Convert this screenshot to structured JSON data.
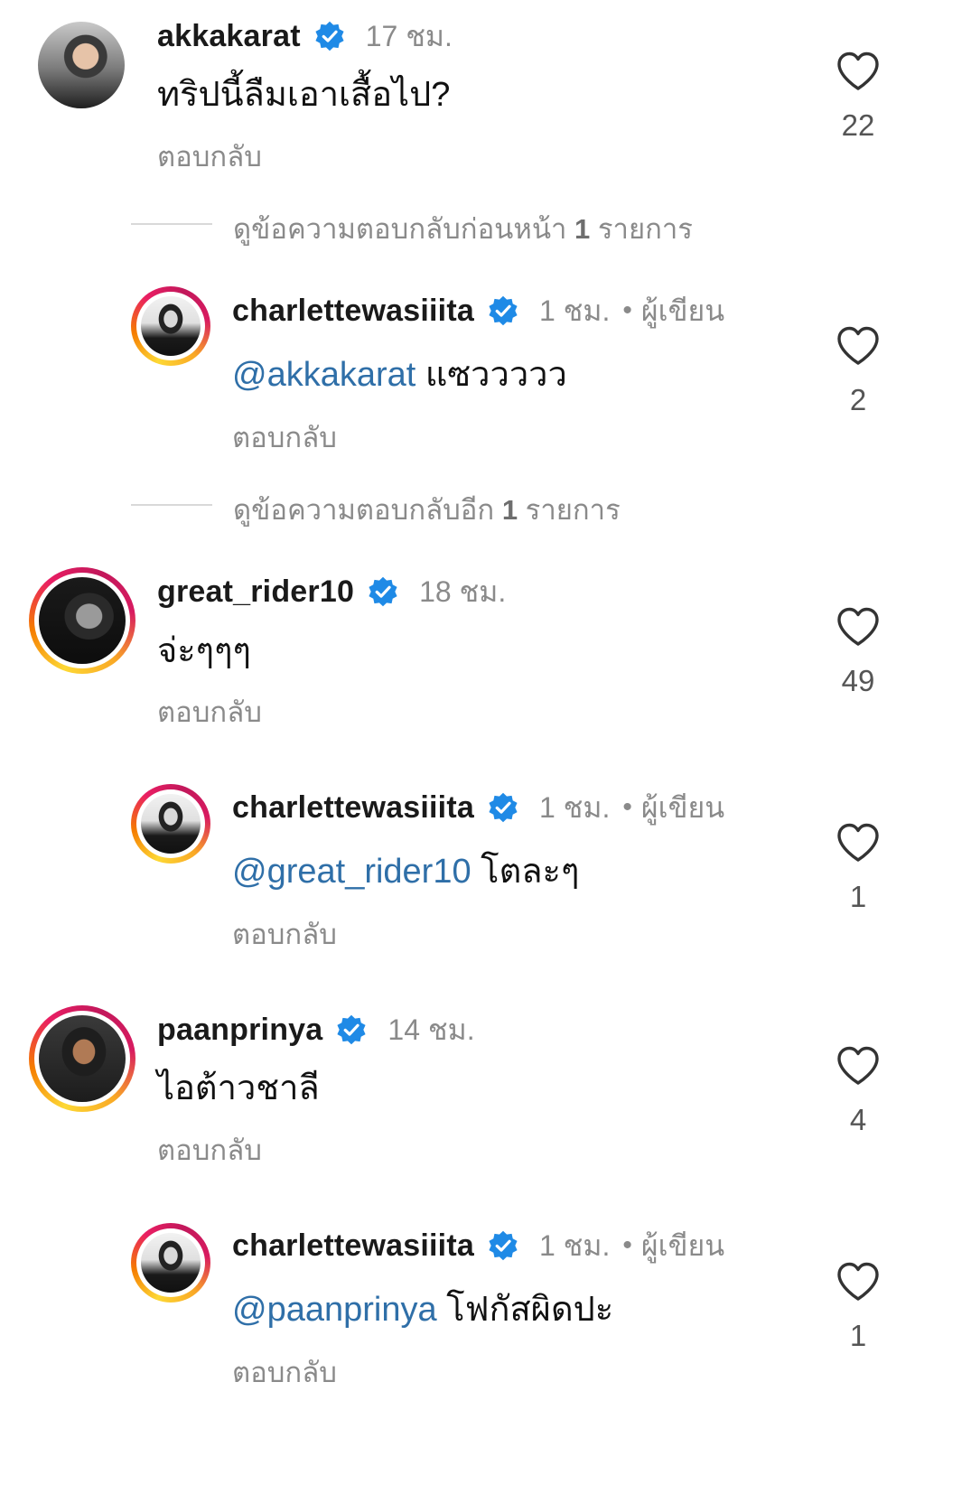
{
  "colors": {
    "mention": "#2f6fa8",
    "secondary_text": "#8a8a8a",
    "verified_badge": "#1f8ae6",
    "story_ring": [
      "#fdd835",
      "#f57c00",
      "#e91e63"
    ]
  },
  "icons": {
    "verified": "verified-badge-icon",
    "like": "heart-outline-icon"
  },
  "reply_label": "ตอบกลับ",
  "comments": [
    {
      "username": "akkakarat",
      "time": "17 ชม.",
      "text": "ทริปนี้ลืมเอาเสื้อไป?",
      "reply": "ตอบกลับ",
      "likes": "22"
    },
    {
      "username": "charlettewasiiita",
      "time": "1 ชม.",
      "author_label": "ผู้เขียน",
      "mention": "@akkakarat",
      "text": " แซววววว",
      "reply": "ตอบกลับ",
      "likes": "2"
    },
    {
      "username": "great_rider10",
      "time": "18 ชม.",
      "text": "จ่ะๆๆๆ",
      "reply": "ตอบกลับ",
      "likes": "49"
    },
    {
      "username": "charlettewasiiita",
      "time": "1 ชม.",
      "author_label": "ผู้เขียน",
      "mention": "@great_rider10",
      "text": " โตละๆ",
      "reply": "ตอบกลับ",
      "likes": "1"
    },
    {
      "username": "paanprinya",
      "time": "14 ชม.",
      "text": "ไอต้าวชาลี",
      "reply": "ตอบกลับ",
      "likes": "4"
    },
    {
      "username": "charlettewasiiita",
      "time": "1 ชม.",
      "author_label": "ผู้เขียน",
      "mention": "@paanprinya",
      "text": " โฟกัสผิดปะ",
      "reply": "ตอบกลับ",
      "likes": "1"
    }
  ],
  "view_replies": [
    {
      "prefix": "ดูข้อความตอบกลับก่อนหน้า ",
      "count": "1",
      "suffix": " รายการ"
    },
    {
      "prefix": "ดูข้อความตอบกลับอีก ",
      "count": "1",
      "suffix": " รายการ"
    }
  ]
}
